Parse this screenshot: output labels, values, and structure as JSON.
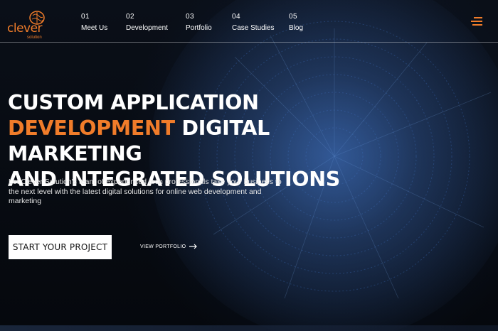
{
  "brand": {
    "name": "clever",
    "tagline": "solution",
    "accent_color": "#f07c2a",
    "logo_icon": "brain-icon"
  },
  "nav": {
    "items": [
      {
        "num": "01",
        "label": "Meet Us"
      },
      {
        "num": "02",
        "label": "Development"
      },
      {
        "num": "03",
        "label": "Portfolio"
      },
      {
        "num": "04",
        "label": "Case Studies"
      },
      {
        "num": "05",
        "label": "Blog"
      }
    ],
    "menu_icon": "hamburger-menu-icon"
  },
  "hero": {
    "line1": "CUSTOM APPLICATION",
    "line2_accent": "DEVELOPMENT",
    "line2_rest": " DIGITAL MARKETING",
    "line3": "AND INTEGRATED SOLUTIONS",
    "description": "Let Clever Solution's team of experienced tech professionals take your business to the next level with the latest digital solutions for online web development and marketing",
    "cta_label": "START YOUR PROJECT",
    "portfolio_link": "VIEW PORTFOLIO",
    "portfolio_icon": "arrow-right-icon"
  },
  "colors": {
    "background": "#05080d",
    "text": "#ffffff",
    "accent": "#f07c2a"
  }
}
